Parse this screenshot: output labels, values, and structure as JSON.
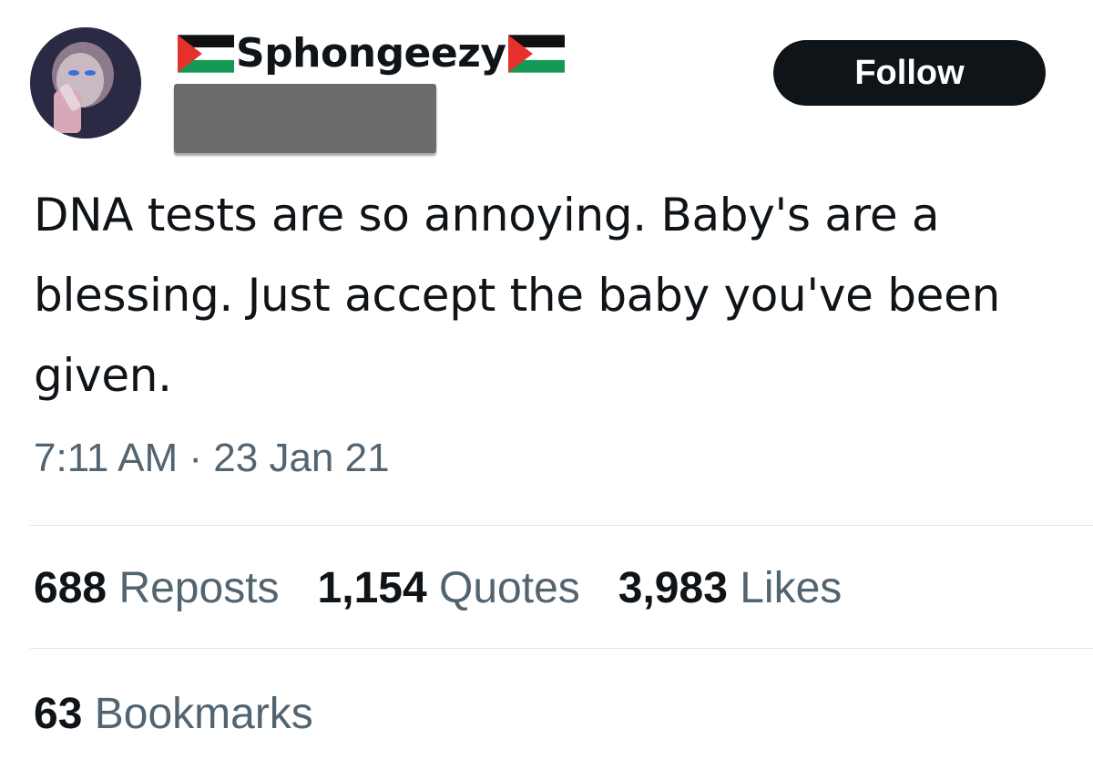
{
  "author": {
    "display_name": "Sphongeezy",
    "flag_icon": "palestine-flag-icon"
  },
  "follow_button": {
    "label": "Follow"
  },
  "tweet": {
    "text": "DNA tests are so annoying. Baby's are a blessing. Just accept the baby you've been given.",
    "time": "7:11 AM",
    "separator": "·",
    "date": "23 Jan 21"
  },
  "stats": {
    "reposts": {
      "count": "688",
      "label": "Reposts"
    },
    "quotes": {
      "count": "1,154",
      "label": "Quotes"
    },
    "likes": {
      "count": "3,983",
      "label": "Likes"
    },
    "bookmarks": {
      "count": "63",
      "label": "Bookmarks"
    }
  },
  "colors": {
    "text_primary": "#0f1419",
    "text_secondary": "#536471",
    "divider": "#e1e6ea",
    "button_bg": "#0f1419",
    "flag_red": "#e4312b",
    "flag_green": "#149954"
  }
}
